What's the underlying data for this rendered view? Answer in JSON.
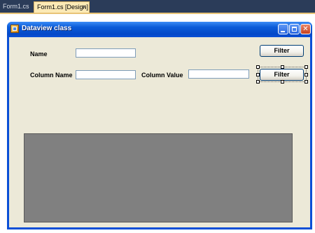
{
  "ide": {
    "tabs": [
      {
        "label": "Form1.cs"
      },
      {
        "label": "Form1.cs [Design]",
        "close": "×"
      }
    ]
  },
  "form": {
    "title": "Dataview class",
    "name_label": "Name",
    "column_name_label": "Column Name",
    "column_value_label": "Column Value",
    "filter_button_top": "Filter",
    "filter_button_bottom": "Filter",
    "name_value": "",
    "column_name_value": "",
    "column_value_value": ""
  }
}
